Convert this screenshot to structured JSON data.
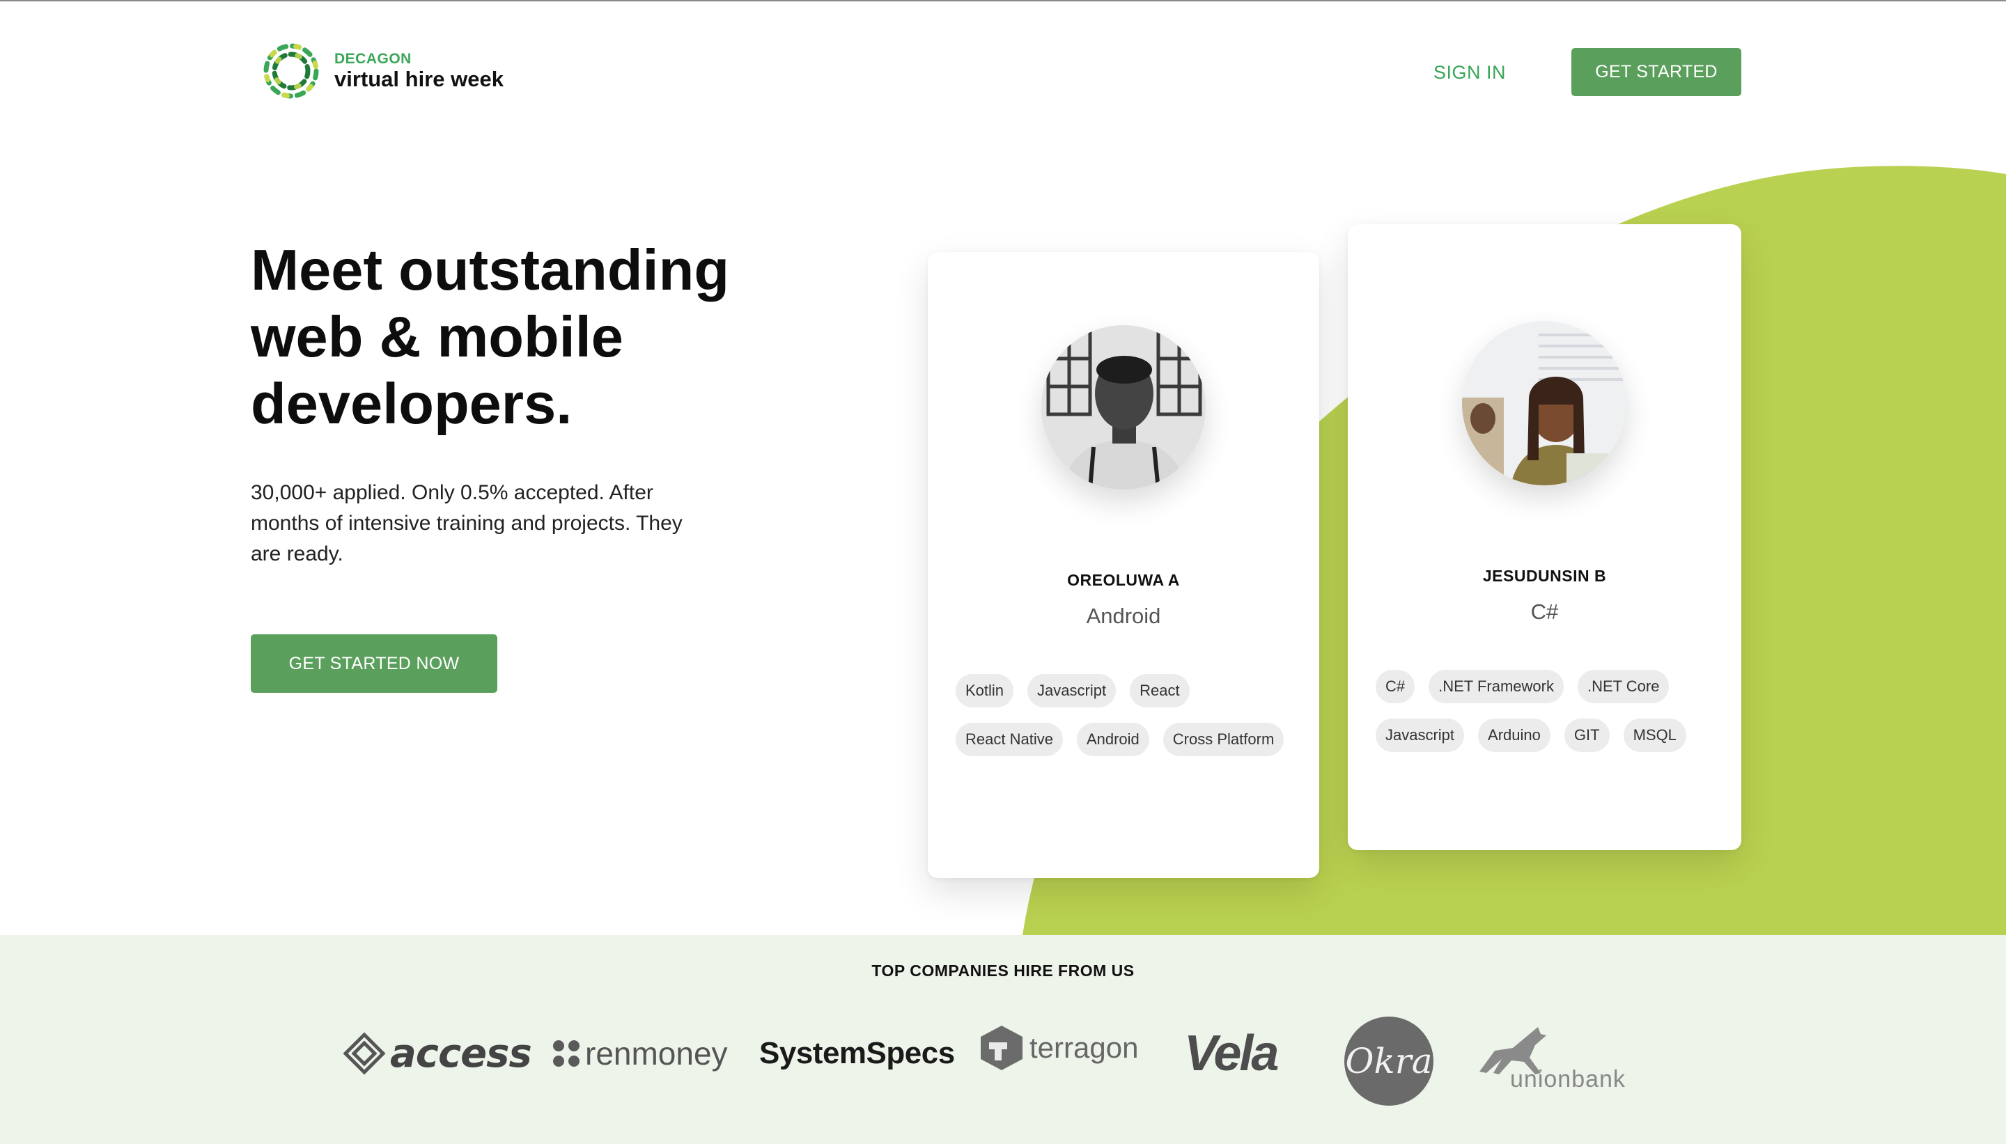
{
  "header": {
    "brand": "DECAGON",
    "product": "virtual hire week",
    "sign_in": "SIGN IN",
    "get_started": "GET STARTED"
  },
  "hero": {
    "title": "Meet outstanding web & mobile developers.",
    "subtitle": "30,000+ applied. Only 0.5% accepted. After months of intensive training and projects. They are ready.",
    "cta": "GET STARTED NOW"
  },
  "developers": [
    {
      "name": "OREOLUWA A",
      "role": "Android",
      "skills": [
        "Kotlin",
        "Javascript",
        "React",
        "React Native",
        "Android",
        "Cross Platform"
      ]
    },
    {
      "name": "JESUDUNSIN B",
      "role": "C#",
      "skills": [
        "C#",
        ".NET Framework",
        ".NET Core",
        "Javascript",
        "Arduino",
        "GIT",
        "MSQL"
      ]
    }
  ],
  "companies": {
    "title": "TOP COMPANIES HIRE FROM US",
    "logos": [
      "access",
      "renmoney",
      "SystemSpecs",
      "terragon",
      "Vela",
      "Okra",
      "unionbank"
    ]
  },
  "colors": {
    "brand_green": "#5b9f5c",
    "accent_lime": "#b4cf4e",
    "band_bg": "#edf4ea"
  }
}
